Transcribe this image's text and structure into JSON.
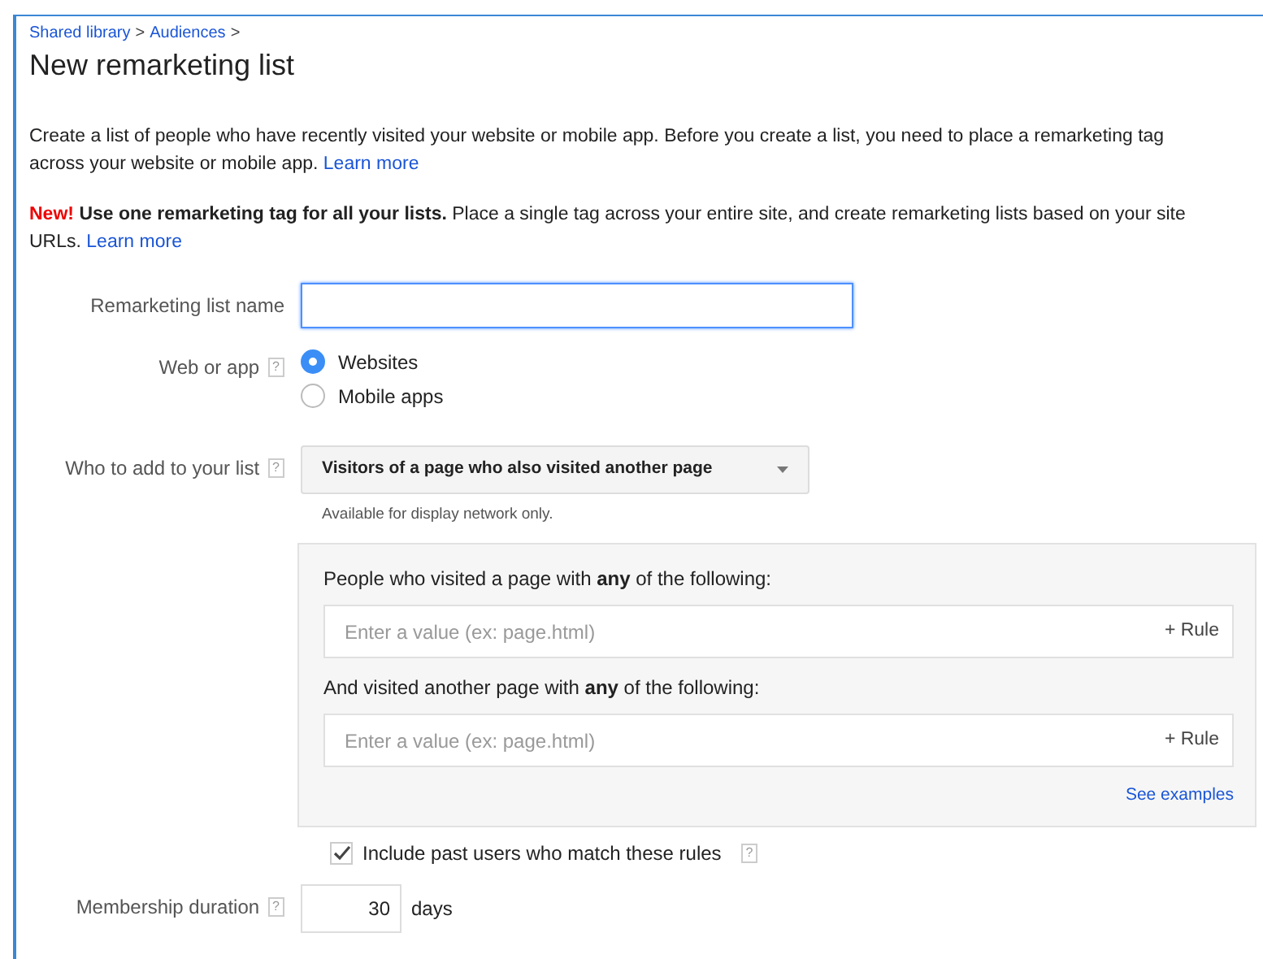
{
  "breadcrumb": [
    {
      "label": "Shared library"
    },
    {
      "label": "Audiences"
    }
  ],
  "breadcrumb_separator": ">",
  "title": "New remarketing list",
  "intro": {
    "text": "Create a list of people who have recently visited your website or mobile app. Before you create a list, you need to place a remarketing tag across your website or mobile app.",
    "link": "Learn more"
  },
  "notice": {
    "badge": "New!",
    "text": "**Use one remarketing tag for all your lists.** Place a single tag across your entire site, and create remarketing lists based on your site URLs.",
    "link": "Learn more"
  },
  "name_field": {
    "label": "Remarketing list name",
    "focused": true
  },
  "web_or_app": {
    "label": "Web or app",
    "help": "?",
    "options": [
      {
        "label": "Websites",
        "selected": true
      },
      {
        "label": "Mobile apps",
        "selected": false
      }
    ]
  },
  "who_to_add": {
    "label": "Who to add to your list",
    "help": "?",
    "value": "Visitors of a page who also visited another page",
    "note": "Available for display network only."
  },
  "rules": [
    {
      "label": "People who visited a page with **any** of the following:",
      "placeholder": "Enter a value (ex: page.html)",
      "add": "+ Rule"
    },
    {
      "label": "And visited another page with **any** of the following:",
      "placeholder": "Enter a value (ex: page.html)",
      "add": "+ Rule"
    }
  ],
  "see_examples": "See examples",
  "include_past": {
    "label": "Include past users who match these rules",
    "help": "?",
    "checked": true
  },
  "membership": {
    "label": "Membership duration",
    "help": "?",
    "value": "30",
    "unit": "days"
  }
}
